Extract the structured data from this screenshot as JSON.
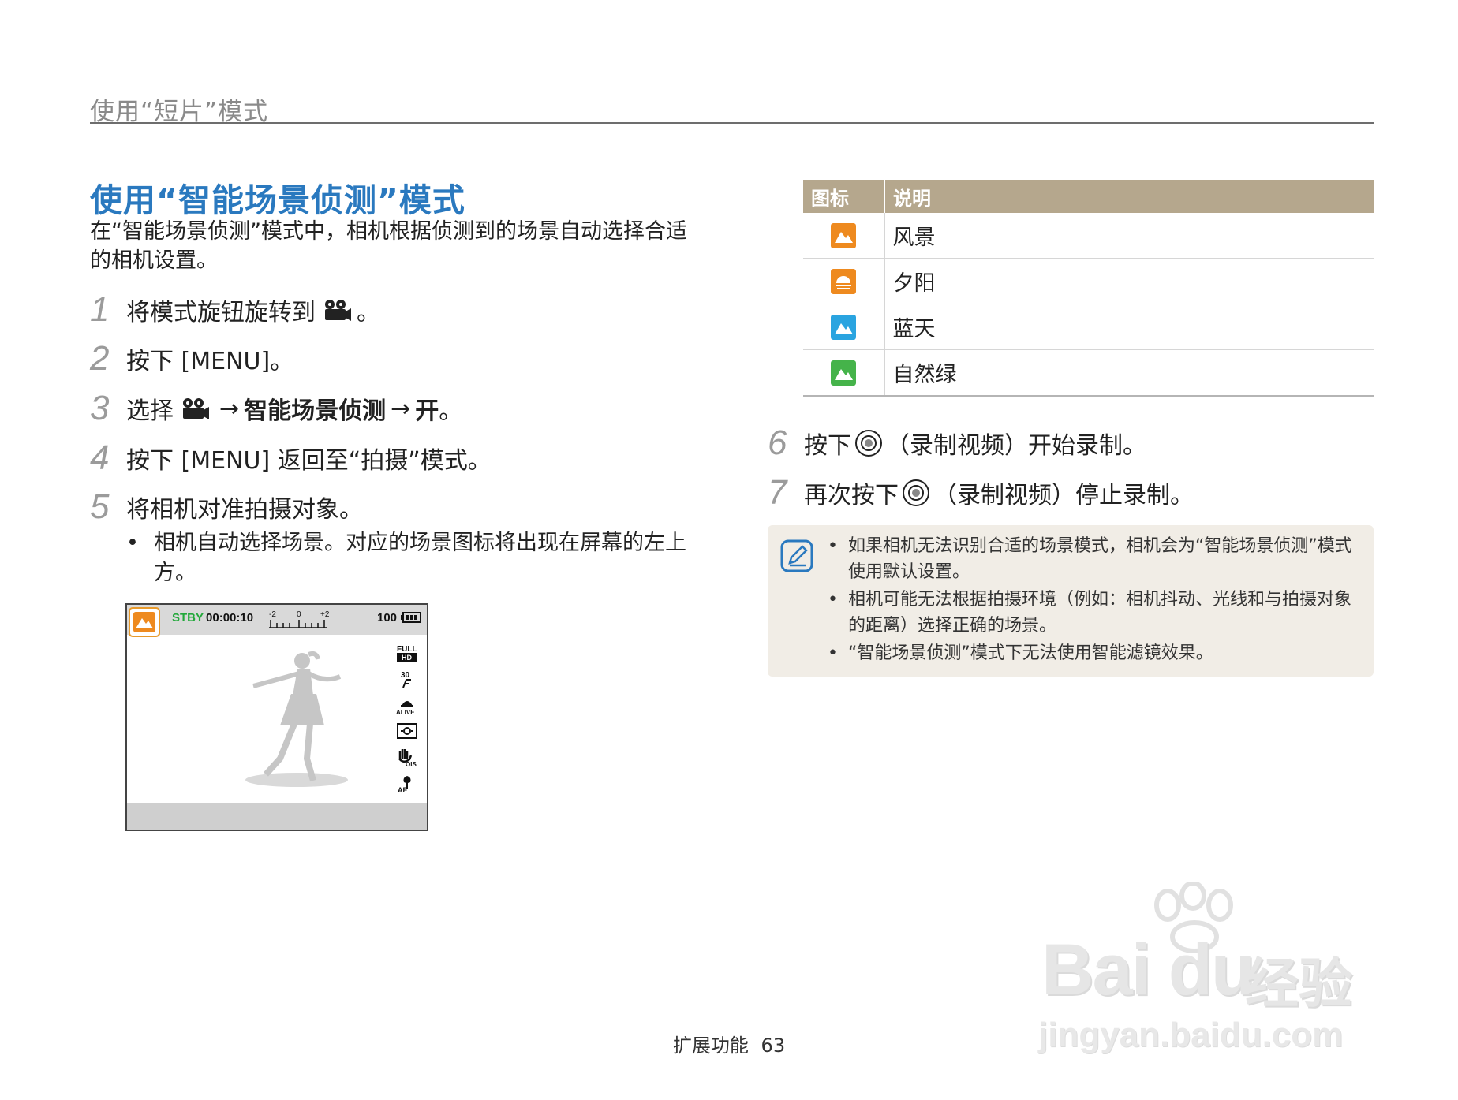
{
  "header": {
    "section_title": "使用“短片”模式"
  },
  "main": {
    "heading": "使用“智能场景侦测”模式",
    "intro": "在“智能场景侦测”模式中，相机根据侦测到的场景自动选择合适的相机设置。",
    "steps": [
      {
        "num": "1",
        "before": "将模式旋钮旋转到",
        "after": "。"
      },
      {
        "num": "2",
        "text": "按下 [MENU]。"
      },
      {
        "num": "3",
        "before": "选择",
        "arrow1": "→",
        "bold1": "智能场景侦测",
        "arrow2": "→",
        "bold2": "开",
        "after": "。"
      },
      {
        "num": "4",
        "text": "按下 [MENU] 返回至“拍摄”模式。"
      },
      {
        "num": "5",
        "text": "将相机对准拍摄对象。"
      }
    ],
    "bullet": "相机自动选择场景。对应的场景图标将出现在屏幕的左上方。",
    "lcd": {
      "stby": "STBY",
      "time": "00:00:10",
      "ev_left": "-2",
      "ev_mid": "0",
      "ev_right": "+2",
      "count": "100",
      "icon_full_top": "FULL",
      "icon_full_bottom": "HD",
      "icon_fps": "30",
      "icon_alive": "ALIVE",
      "icon_ois": "OIS",
      "icon_af": "AF"
    }
  },
  "table": {
    "headers": [
      "图标",
      "说明"
    ],
    "rows": [
      {
        "label": "风景",
        "color": "#ee8a1f",
        "icon": "landscape-icon"
      },
      {
        "label": "夕阳",
        "color": "#ee8a1f",
        "icon": "sunset-icon"
      },
      {
        "label": "蓝天",
        "color": "#2aa4e0",
        "icon": "blue-sky-icon"
      },
      {
        "label": "自然绿",
        "color": "#45b34a",
        "icon": "natural-green-icon"
      }
    ]
  },
  "steps_right": [
    {
      "num": "6",
      "before": "按下",
      "after": "（录制视频）开始录制。"
    },
    {
      "num": "7",
      "before": "再次按下",
      "after": "（录制视频）停止录制。"
    }
  ],
  "note": {
    "items": [
      "如果相机无法识别合适的场景模式，相机会为“智能场景侦测”模式使用默认设置。",
      "相机可能无法根据拍摄环境（例如：相机抖动、光线和与拍摄对象的距离）选择正确的场景。",
      "“智能场景侦测”模式下无法使用智能滤镜效果。"
    ]
  },
  "footer": {
    "section": "扩展功能",
    "page": "63"
  },
  "watermark": {
    "brand": "Bai du",
    "cn": "经验",
    "url": "jingyan.baidu.com"
  },
  "colors": {
    "heading": "#2a79bf",
    "table_header": "#b5a78d",
    "note_bg": "#f1ede6",
    "stby": "#22a83a"
  }
}
